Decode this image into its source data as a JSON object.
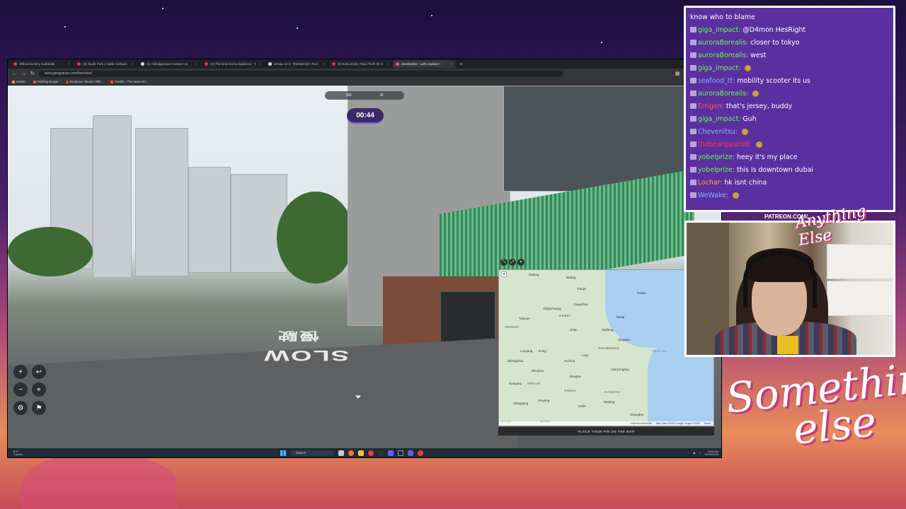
{
  "browser": {
    "tabs": [
      {
        "label": "Official Destiny Subreddit"
      },
      {
        "label": "(3) South Park | Cable Compan"
      },
      {
        "label": "(1) Antiobgessant Content on"
      },
      {
        "label": "(3) The BAD Nurse Epidemic - Y"
      },
      {
        "label": "vesiau on X: \"ExtraEmily's frien"
      },
      {
        "label": "(3) Extra Emily Plays Truth Or D"
      },
      {
        "label": "GeoGuessr - Let's explore t"
      }
    ],
    "new_tab": "+",
    "url": "www.geoguessr.com/free/start",
    "bookmarks": [
      "Dailies",
      "Nothing Burger",
      "Bodycam Shows Offic...",
      "Reddit - The heart of t..."
    ]
  },
  "game": {
    "compass_left": "SW",
    "compass_right": "W",
    "timer": "00:44",
    "zoom_in": "+",
    "zoom_out": "−",
    "undo": "↩",
    "guess_button": "PLACE YOUR PIN ON THE MAP",
    "road_text_1": "SLOW",
    "road_text_2": "慢駛"
  },
  "map": {
    "labels": [
      "Datong",
      "Beijing",
      "Tianjin",
      "Dalian",
      "Shijiazhuang",
      "Cangzhou",
      "HEBEI",
      "SHANXI",
      "Taiyuan",
      "Jinan",
      "Weifang",
      "Qingdao",
      "Yantai",
      "Luoyang",
      "Zhengzhou",
      "SHANDONG",
      "Linyi",
      "Xuzhou",
      "Jining",
      "Zhoukou",
      "Bengbu",
      "HENAN",
      "Xinyang",
      "Hefei",
      "Nanjing",
      "JIANGSU",
      "Shanghai",
      "Wuhan",
      "Xiangyang",
      "Lianyungang",
      "Nanyang",
      "Yellow Sea",
      "ANHUI"
    ],
    "footer_left": "Keyboard shortcuts",
    "footer_mid": "Map Data ©2025 Google, Image ©2025",
    "footer_right": "Terms",
    "google": "Google"
  },
  "taskbar": {
    "weather_temp": "8°C",
    "weather_desc": "Cloudy",
    "search": "Search",
    "time": "5:03 AM",
    "date": "12/29/2025"
  },
  "chat": {
    "messages": [
      {
        "user": "",
        "text": "know who to blame",
        "color": "#ffffff"
      },
      {
        "user": "giga_impact:",
        "text": "@D4mon HesRight",
        "color": "#5dff4a"
      },
      {
        "user": "auroraBorealis:",
        "text": "closer to tokyo",
        "color": "#5dff4a"
      },
      {
        "user": "auroraBorealis:",
        "text": "west",
        "color": "#5dff4a"
      },
      {
        "user": "giga_impact:",
        "text": "",
        "color": "#5dff4a"
      },
      {
        "user": "seafood_tt:",
        "text": "mobility scooter its us",
        "color": "#7bb6ff"
      },
      {
        "user": "auroraBorealis:",
        "text": "",
        "color": "#5dff4a"
      },
      {
        "user": "Errigen:",
        "text": "that's jersey, buddy",
        "color": "#ff5a5a"
      },
      {
        "user": "giga_impact:",
        "text": "Guh",
        "color": "#5dff4a"
      },
      {
        "user": "Chevenitsu:",
        "text": "",
        "color": "#7bb6ff"
      },
      {
        "user": "thebearippard6:",
        "text": "",
        "color": "#ff3d3d"
      },
      {
        "user": "yobelprize:",
        "text": "heey it's my place",
        "color": "#5dff4a"
      },
      {
        "user": "yobelprize:",
        "text": "this is downtown dubai",
        "color": "#5dff4a"
      },
      {
        "user": "Lochar:",
        "text": "hk isnt china",
        "color": "#ffa640"
      },
      {
        "user": "WeWake:",
        "text": "",
        "color": "#7bb6ff"
      }
    ]
  },
  "overlay": {
    "patreon": "PATREON.COM/",
    "logo_small": "Anything Else",
    "brand_line1": "Something",
    "brand_line2": "else"
  },
  "colors": {
    "accent": "#5c2fa0",
    "timer_bg": "#3b2a68"
  }
}
